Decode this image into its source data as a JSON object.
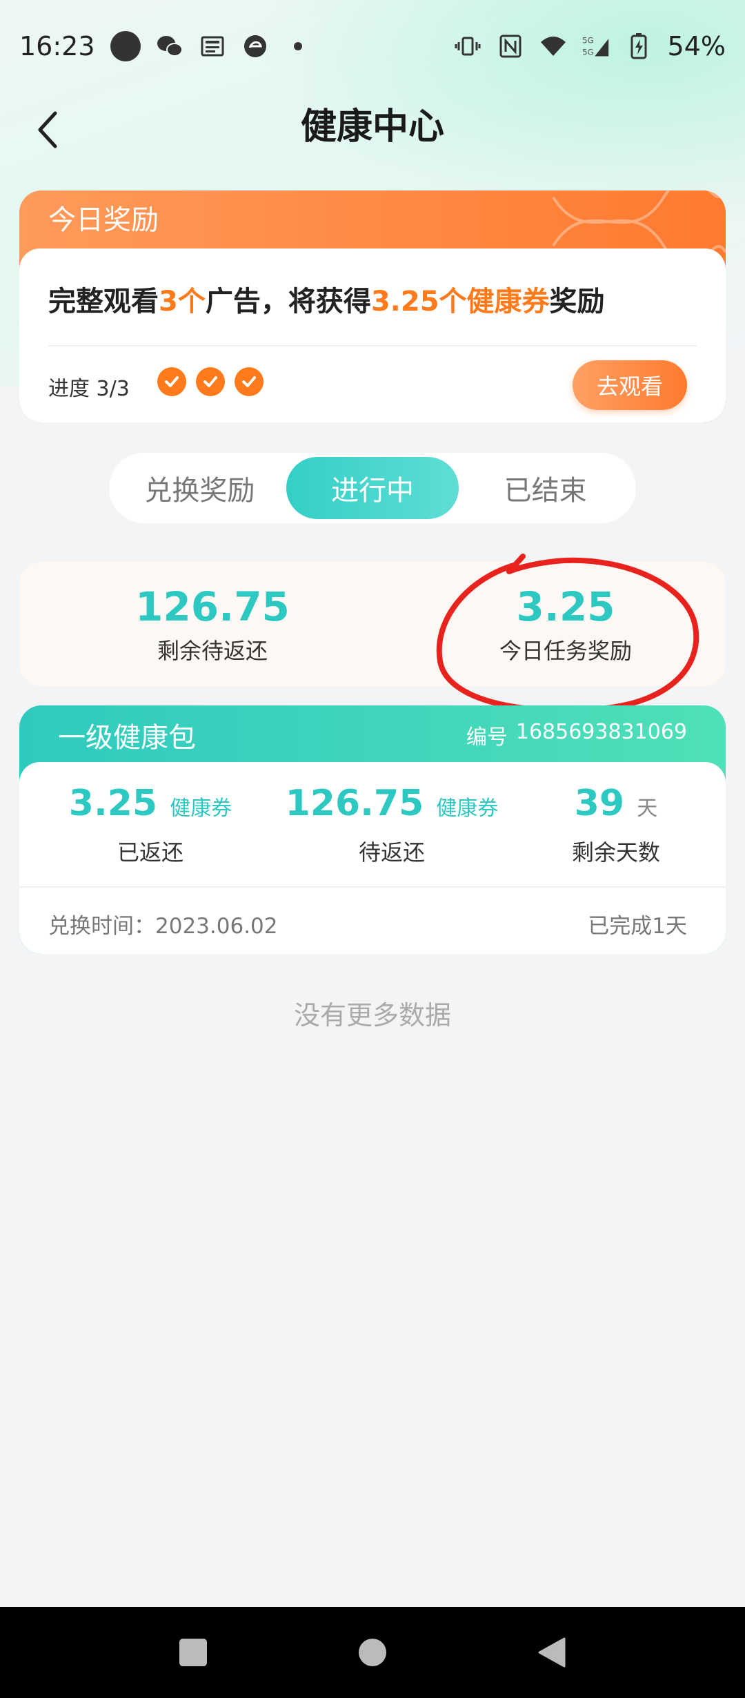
{
  "status_bar": {
    "time": "16:23",
    "battery": "54%",
    "net_label": "5G",
    "icons": [
      "circle-icon",
      "wechat-icon",
      "news-icon",
      "browser-icon",
      "dot-icon",
      "vibrate-icon",
      "nfc-icon",
      "wifi-icon",
      "signal-icon",
      "battery-icon"
    ]
  },
  "header": {
    "title": "健康中心",
    "back_icon": "chevron-left-icon"
  },
  "daily_reward": {
    "title": "今日奖励",
    "text_1": "完整观看",
    "count": "3个",
    "text_2": "广告，将获得",
    "reward_amount": "3.25个健康券",
    "text_3": "奖励",
    "progress_label": "进度 3/3",
    "progress_value": 3,
    "progress_total": 3,
    "watch_button": "去观看"
  },
  "tabs": [
    {
      "label": "兑换奖励",
      "active": false
    },
    {
      "label": "进行中",
      "active": true
    },
    {
      "label": "已结束",
      "active": false
    }
  ],
  "summary": {
    "remaining_value": "126.75",
    "remaining_label": "剩余待返还",
    "today_value": "3.25",
    "today_label": "今日任务奖励"
  },
  "package": {
    "title": "一级健康包",
    "id_label": "编号",
    "id_value": "1685693831069",
    "returned_value": "3.25",
    "returned_unit": "健康券",
    "returned_label": "已返还",
    "pending_value": "126.75",
    "pending_unit": "健康券",
    "pending_label": "待返还",
    "days_value": "39",
    "days_unit": "天",
    "days_label": "剩余天数",
    "exchange_time": "兑换时间：2023.06.02",
    "completed": "已完成1天"
  },
  "footer": {
    "no_more": "没有更多数据"
  },
  "colors": {
    "accent_teal": "#2ec8c2",
    "accent_orange": "#ff7a1a",
    "annotation_red": "#e8231d"
  }
}
